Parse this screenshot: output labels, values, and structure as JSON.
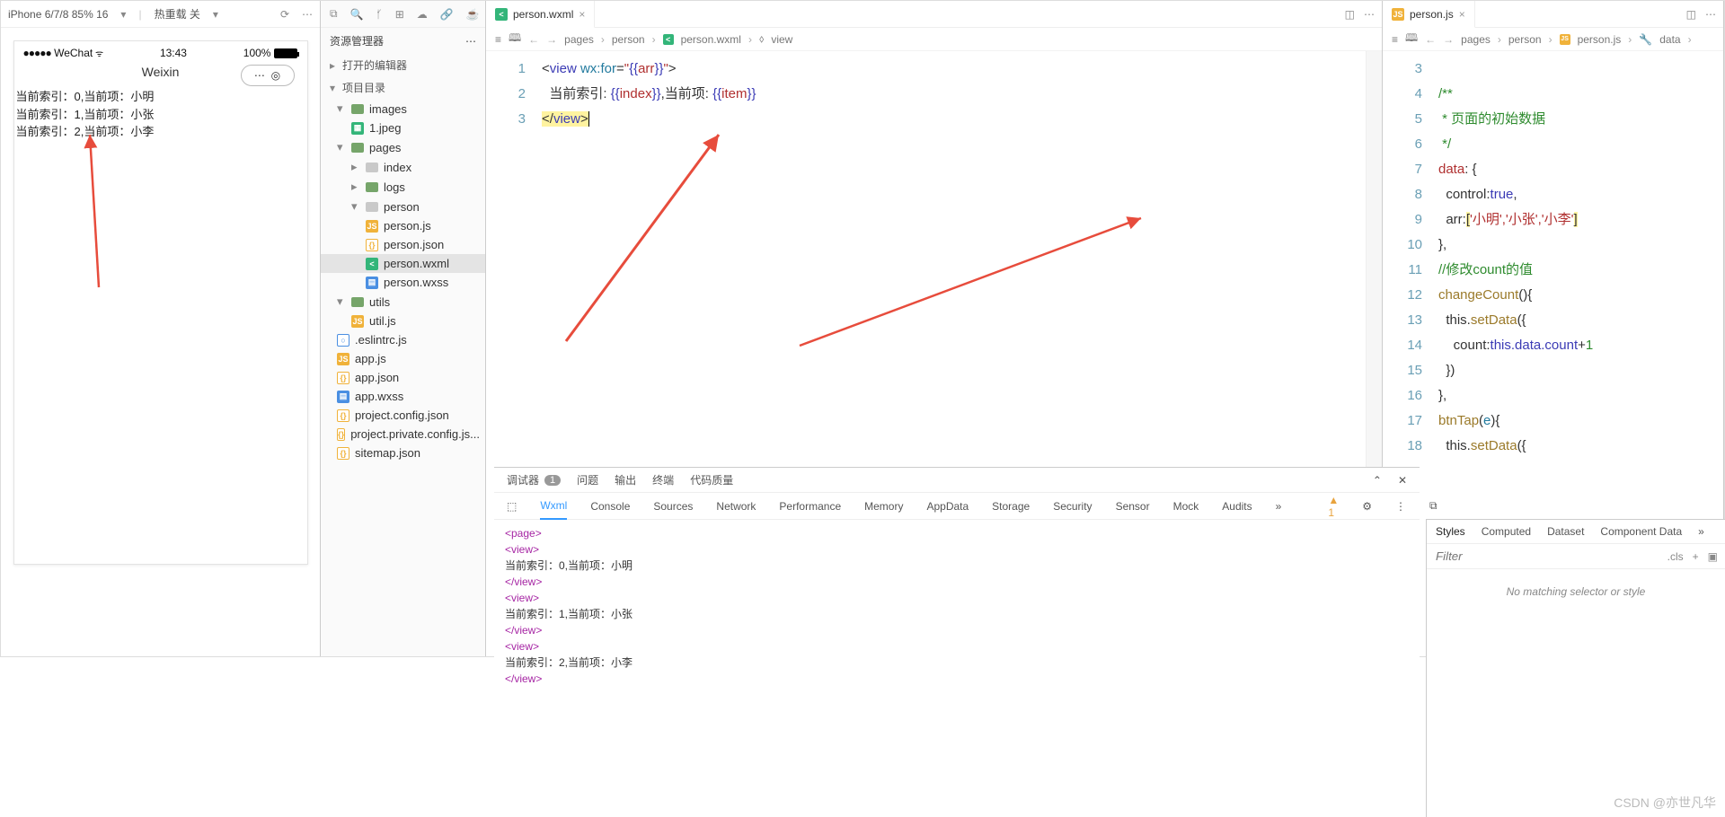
{
  "simTop": {
    "device": "iPhone 6/7/8 85% 16",
    "reload": "热重载 关"
  },
  "phone": {
    "wechat": "WeChat",
    "time": "13:43",
    "battery": "100%",
    "title": "Weixin",
    "lines": [
      "当前索引：0,当前项：小明",
      "当前索引：1,当前项：小张",
      "当前索引：2,当前项：小李"
    ]
  },
  "explorer": {
    "title": "资源管理器",
    "sec1": "打开的编辑器",
    "sec2": "项目目录",
    "items": [
      {
        "lvl": 1,
        "ic": "fo",
        "lbl": "images",
        "car": "▾"
      },
      {
        "lvl": 2,
        "ic": "img",
        "lbl": "1.jpeg"
      },
      {
        "lvl": 1,
        "ic": "fo",
        "lbl": "pages",
        "car": "▾"
      },
      {
        "lvl": 2,
        "ic": "fogray",
        "lbl": "index",
        "car": "▸"
      },
      {
        "lvl": 2,
        "ic": "fo",
        "lbl": "logs",
        "car": "▸"
      },
      {
        "lvl": 2,
        "ic": "fogray",
        "lbl": "person",
        "car": "▾"
      },
      {
        "lvl": 3,
        "ic": "js",
        "lbl": "person.js"
      },
      {
        "lvl": 3,
        "ic": "json",
        "lbl": "person.json"
      },
      {
        "lvl": 3,
        "ic": "wxml",
        "lbl": "person.wxml",
        "sel": true
      },
      {
        "lvl": 3,
        "ic": "wxss",
        "lbl": "person.wxss"
      },
      {
        "lvl": 1,
        "ic": "fo",
        "lbl": "utils",
        "car": "▾"
      },
      {
        "lvl": 2,
        "ic": "js",
        "lbl": "util.js"
      },
      {
        "lvl": 1,
        "ic": "es",
        "lbl": ".eslintrc.js",
        "car": ""
      },
      {
        "lvl": 1,
        "ic": "js",
        "lbl": "app.js",
        "car": ""
      },
      {
        "lvl": 1,
        "ic": "json",
        "lbl": "app.json",
        "car": ""
      },
      {
        "lvl": 1,
        "ic": "wxss",
        "lbl": "app.wxss",
        "car": ""
      },
      {
        "lvl": 1,
        "ic": "json",
        "lbl": "project.config.json",
        "car": ""
      },
      {
        "lvl": 1,
        "ic": "json",
        "lbl": "project.private.config.js...",
        "car": ""
      },
      {
        "lvl": 1,
        "ic": "json",
        "lbl": "sitemap.json",
        "car": ""
      }
    ]
  },
  "ed1": {
    "tab": "person.wxml",
    "crumbs": [
      "pages",
      "person",
      "person.wxml",
      "view"
    ],
    "lines": [
      "1",
      "2",
      "3"
    ]
  },
  "wxml": {
    "open": "<view wx:for=\"{{arr}}\">",
    "mid": "  当前索引: {{index}},当前项: {{item}}",
    "close": "</view>"
  },
  "ed2": {
    "tab": "person.js",
    "crumbs": [
      "pages",
      "person",
      "person.js",
      "data"
    ],
    "lines": [
      "3",
      "4",
      "5",
      "6",
      "7",
      "8",
      "9",
      "10",
      "11",
      "12",
      "13",
      "14",
      "15",
      "16",
      "17",
      "18"
    ]
  },
  "js": {
    "l4": "/**",
    "l5": " * 页面的初始数据",
    "l6": " */",
    "l7a": "data",
    "l7b": ": {",
    "l8a": "  control:",
    "l8b": "true",
    "l8c": ",",
    "l9a": "  arr:",
    "l9b": "[",
    "l9c": "'小明','小张','小李'",
    "l9d": "]",
    "l10": "},",
    "l11": "//修改count的值",
    "l12a": "changeCount",
    "l12b": "(){",
    "l13a": "  this.",
    "l13b": "setData",
    "l13c": "({",
    "l14a": "    count:",
    "l14b": "this.data.count",
    "l14c": "+",
    "l14d": "1",
    "l15": "  })",
    "l16": "},",
    "l17a": "btnTap",
    "l17b": "(",
    "l17c": "e",
    "l17d": "){",
    "l18a": "  this.",
    "l18b": "setData",
    "l18c": "({"
  },
  "dbg": {
    "tabs": [
      "调试器",
      "问题",
      "输出",
      "终端",
      "代码质量"
    ],
    "count": "1",
    "tools": [
      "Wxml",
      "Console",
      "Sources",
      "Network",
      "Performance",
      "Memory",
      "AppData",
      "Storage",
      "Security",
      "Sensor",
      "Mock",
      "Audits"
    ],
    "warn": "1",
    "wxml": [
      "<page>",
      "  <view>",
      "    当前索引：0,当前项：小明",
      "  </view>",
      "  <view>",
      "    当前索引：1,当前项：小张",
      "  </view>",
      "  <view>",
      "    当前索引：2,当前项：小李",
      "  </view>"
    ]
  },
  "sty": {
    "tabs": [
      "Styles",
      "Computed",
      "Dataset",
      "Component Data"
    ],
    "filter": "Filter",
    "cls": ".cls",
    "msg": "No matching selector or style"
  },
  "watermark": "CSDN @亦世凡华"
}
